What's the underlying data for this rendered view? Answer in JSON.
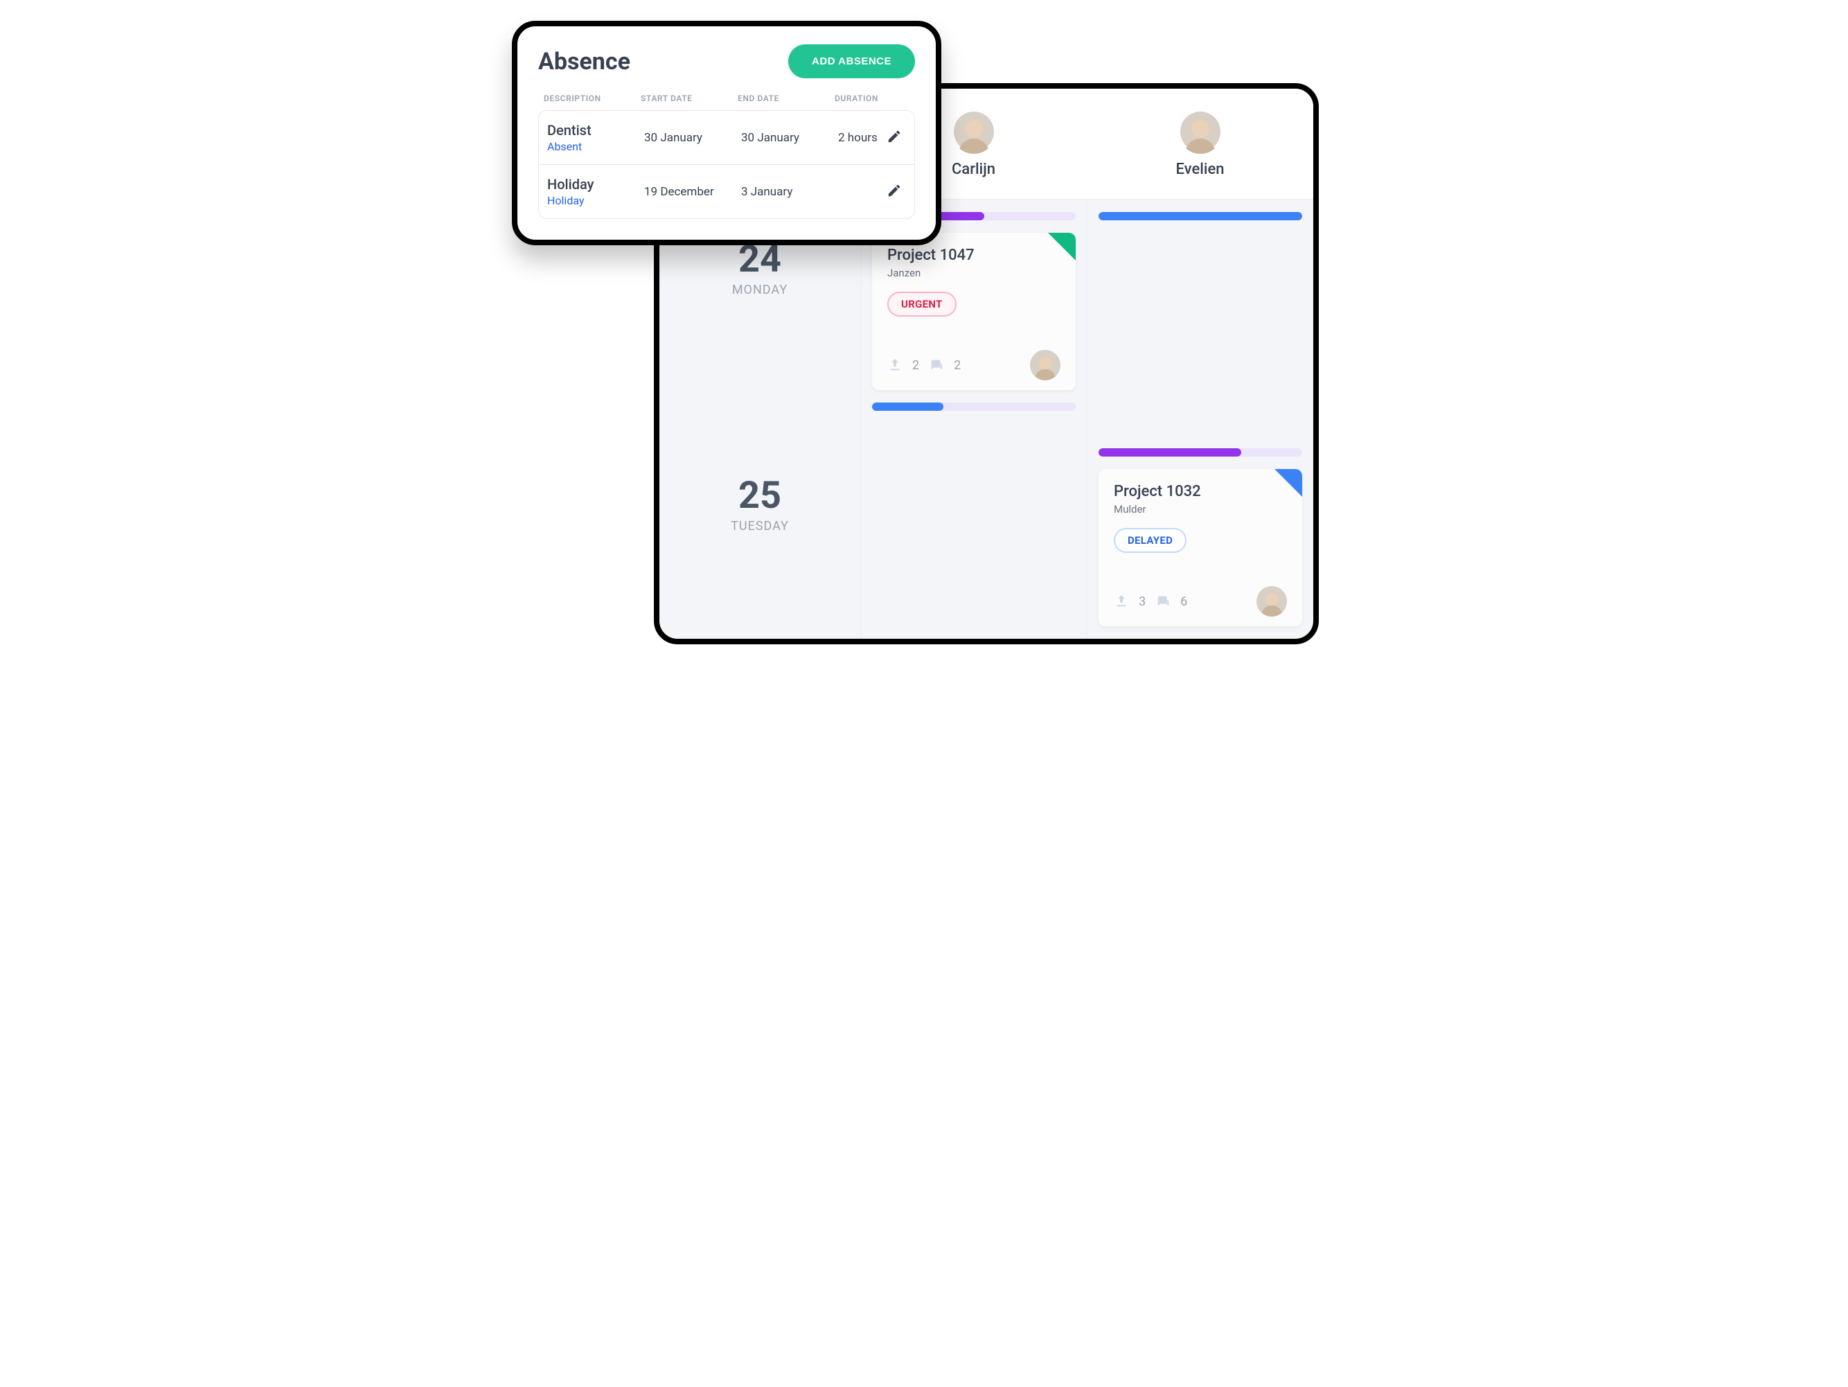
{
  "absence": {
    "title": "Absence",
    "add_label": "ADD ABSENCE",
    "columns": {
      "description": "DESCRIPTION",
      "start": "START DATE",
      "end": "END DATE",
      "duration": "DURATION"
    },
    "rows": [
      {
        "description": "Dentist",
        "tag": "Absent",
        "start": "30 January",
        "end": "30 January",
        "duration": "2 hours"
      },
      {
        "description": "Holiday",
        "tag": "Holiday",
        "start": "19 December",
        "end": "3 January",
        "duration": ""
      }
    ]
  },
  "board": {
    "people": [
      {
        "name": "Carlijn"
      },
      {
        "name": "Evelien"
      }
    ],
    "days": [
      {
        "num": "24",
        "name": "MONDAY",
        "lanes": [
          {
            "progress": {
              "color": "purple",
              "pct": 55
            },
            "task": {
              "title": "Project 1047",
              "sub": "Janzen",
              "badge": "URGENT",
              "badge_type": "urgent",
              "corner": "green",
              "uploads": "2",
              "comments": "2"
            },
            "progress_after": {
              "color": "blue",
              "pct": 35
            }
          },
          {
            "progress": {
              "color": "blue",
              "pct": 100
            }
          }
        ]
      },
      {
        "num": "25",
        "name": "TUESDAY",
        "lanes": [
          {},
          {
            "progress": {
              "color": "purple",
              "pct": 70
            },
            "task": {
              "title": "Project 1032",
              "sub": "Mulder",
              "badge": "DELAYED",
              "badge_type": "delayed",
              "corner": "blue",
              "uploads": "3",
              "comments": "6"
            }
          }
        ]
      }
    ]
  }
}
